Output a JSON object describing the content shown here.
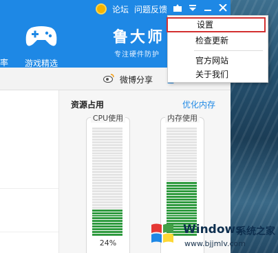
{
  "topbar": {
    "forum": "论坛",
    "feedback": "问题反馈"
  },
  "sidebar_partial_char": "率",
  "game_label": "游戏精选",
  "brand": {
    "title": "鲁大师",
    "subtitle": "专注硬件防护"
  },
  "share": {
    "label": "微博分享"
  },
  "resource": {
    "title": "资源占用",
    "optimize": "优化内存",
    "cpu": {
      "label": "CPU使用",
      "percent_text": "24%",
      "usage": 0.24
    },
    "memory": {
      "label": "内存使用",
      "usage": 0.5
    }
  },
  "menu": {
    "items": [
      "设置",
      "检查更新",
      "官方网站",
      "关于我们"
    ],
    "highlighted": "设置"
  },
  "watermark": {
    "title": "Windows",
    "title2": "系统之家",
    "url": "www.bjjmlv.com"
  },
  "colors": {
    "header_blue": "#1e88e5",
    "bar_green": "#2e9a3e",
    "highlight_red": "#d32f2f"
  }
}
